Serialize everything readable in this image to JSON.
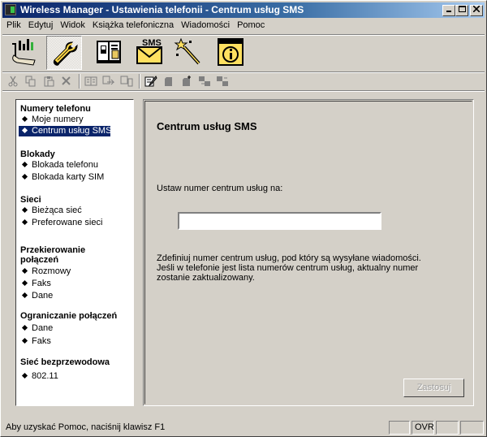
{
  "window": {
    "title": "Wireless Manager - Ustawienia telefonii - Centrum usług SMS",
    "controls": [
      "minimize-icon",
      "maximize-icon",
      "close-icon"
    ]
  },
  "menu": [
    "Plik",
    "Edytuj",
    "Widok",
    "Książka telefoniczna",
    "Wiadomości",
    "Pomoc"
  ],
  "toolbar_main": [
    {
      "icon": "phone-connection-icon"
    },
    {
      "icon": "wrench-settings-icon",
      "pressed": true
    },
    {
      "icon": "phonebook-icon"
    },
    {
      "icon": "sms-envelope-icon",
      "label": "SMS"
    },
    {
      "icon": "magic-wand-icon"
    },
    {
      "icon": "info-icon"
    }
  ],
  "toolbar_secondary": [
    "cut-icon",
    "copy-icon",
    "paste-icon",
    "delete-icon",
    "book-icon",
    "copy-to-phone-icon",
    "copy-from-phone-icon",
    "edit-icon",
    "sim-icon",
    "sim-plus-icon",
    "transfer-right-icon",
    "transfer-left-icon"
  ],
  "sidebar": {
    "groups": [
      {
        "title": "Numery telefonu",
        "items": [
          "Moje numery",
          "Centrum usług SMS"
        ]
      },
      {
        "title": "Blokady",
        "items": [
          "Blokada telefonu",
          "Blokada karty SIM"
        ]
      },
      {
        "title": "Sieci",
        "items": [
          "Bieżąca sieć",
          "Preferowane sieci"
        ]
      },
      {
        "title": "Przekierowanie połączeń",
        "items": [
          "Rozmowy",
          "Faks",
          "Dane"
        ]
      },
      {
        "title": "Ograniczanie połączeń",
        "items": [
          "Dane",
          "Faks"
        ]
      },
      {
        "title": "Sieć bezprzewodowa",
        "items": [
          "802.11"
        ]
      }
    ],
    "selected": "Centrum usług SMS"
  },
  "content": {
    "title": "Centrum usług SMS",
    "label": "Ustaw numer centrum usług na:",
    "input_value": "",
    "description": "Zdefiniuj numer centrum usług, pod który są wysyłane wiadomości. Jeśli w telefonie jest lista numerów centrum usług, aktualny numer zostanie zaktualizowany.",
    "apply_button": "Zastosuj"
  },
  "status": {
    "text": "Aby uzyskać Pomoc, naciśnij klawisz F1",
    "ovr": "OVR"
  },
  "colors": {
    "face": "#d4d0c8",
    "title_start": "#0a246a",
    "title_end": "#a6caf0",
    "selection": "#0a246a"
  }
}
